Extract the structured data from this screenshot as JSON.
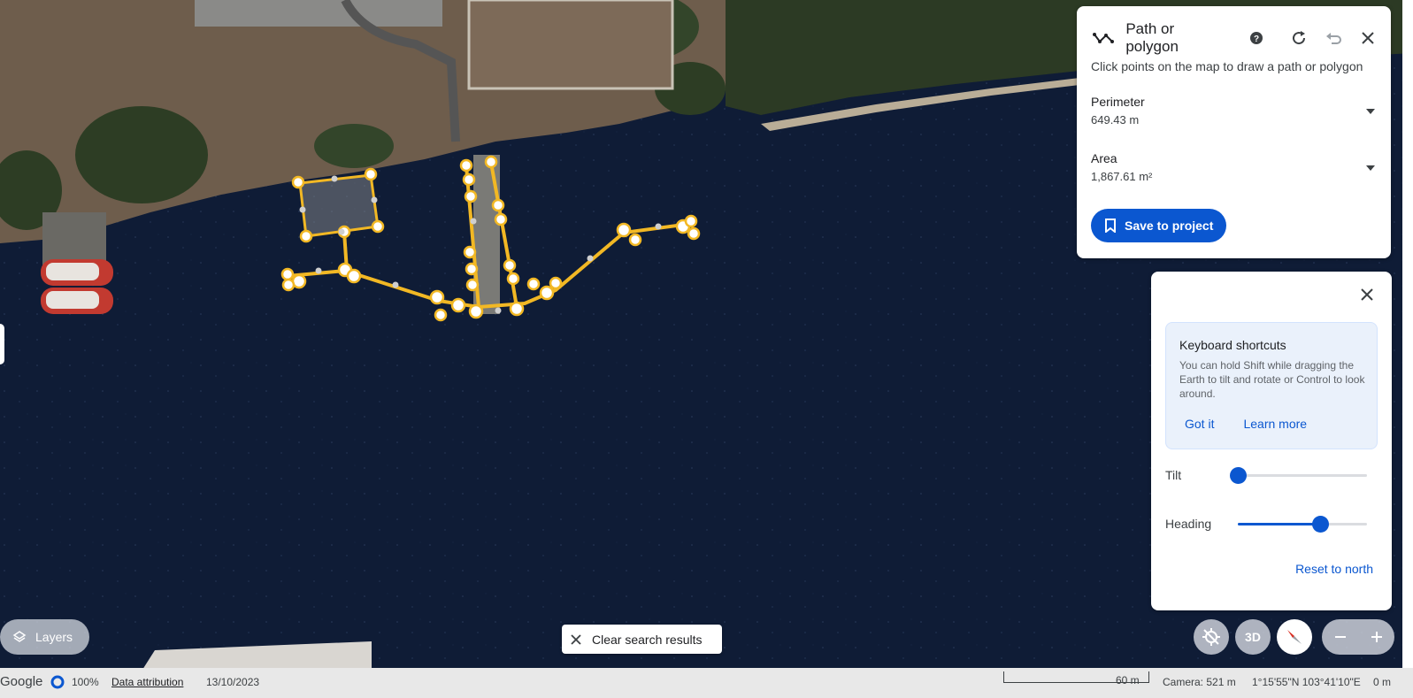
{
  "measure_panel": {
    "title": "Path or polygon",
    "hint": "Click points on the map to draw a path or polygon",
    "perimeter_label": "Perimeter",
    "perimeter_value": "649.43 m",
    "area_label": "Area",
    "area_value": "1,867.61 m²",
    "save_label": "Save to project",
    "icons": [
      "path-icon",
      "help-icon",
      "refresh-icon",
      "undo-icon",
      "close-icon"
    ]
  },
  "view_panel": {
    "kb_title": "Keyboard shortcuts",
    "kb_text": "You can hold Shift while dragging the Earth to tilt and rotate or Control to look around.",
    "got_it": "Got it",
    "learn_more": "Learn more",
    "tilt_label": "Tilt",
    "tilt_level": 0,
    "heading_label": "Heading",
    "heading_level": 0.64,
    "reset_label": "Reset to north"
  },
  "controls": {
    "layers_label": "Layers",
    "clear_label": "Clear search results",
    "three_d_label": "3D",
    "zoom_out": "−",
    "zoom_in": "+"
  },
  "status": {
    "brand": "Google",
    "percent": "100%",
    "attribution": "Data attribution",
    "date": "13/10/2023",
    "scale": "60 m",
    "camera": "Camera: 521 m",
    "coords": "1°15'55\"N 103°41'10\"E",
    "elevation": "0 m"
  },
  "colors": {
    "accent": "#0b57d0",
    "water": "#0e1b33",
    "path": "#f2b824"
  }
}
